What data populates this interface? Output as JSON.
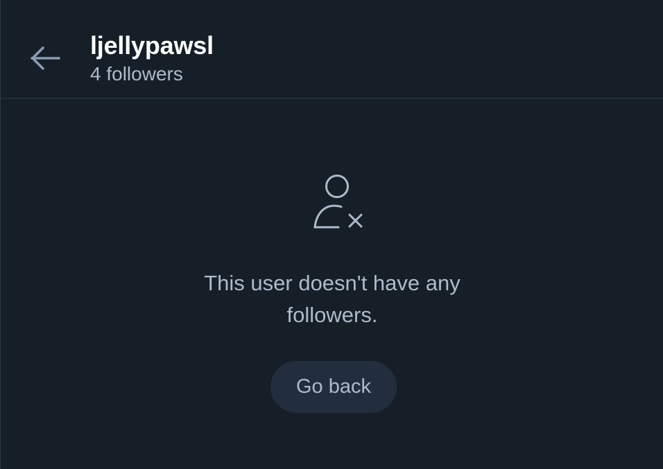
{
  "header": {
    "back_icon": "arrow-left-icon",
    "title": "ljellypawsl",
    "subtitle": "4 followers"
  },
  "empty_state": {
    "icon": "person-x-icon",
    "message": "This user doesn't have any followers.",
    "button_label": "Go back"
  },
  "colors": {
    "background": "#161e27",
    "title": "#ffffff",
    "muted_text": "#aebbcc",
    "button_bg": "#222e3e",
    "divider": "#232e3b"
  }
}
